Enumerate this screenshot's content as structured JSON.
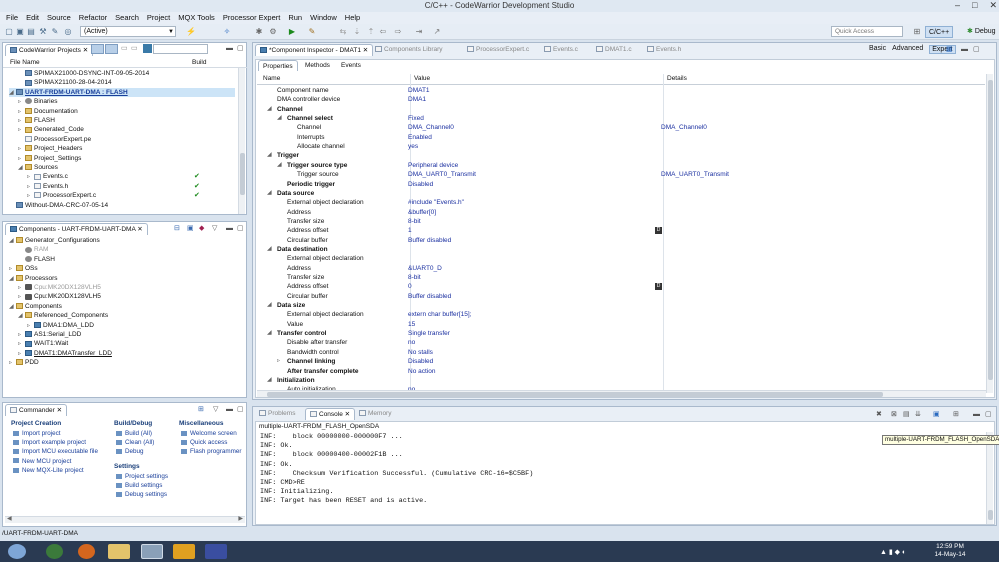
{
  "window": {
    "title": "C/C++ - CodeWarrior Development Studio"
  },
  "menu": [
    "File",
    "Edit",
    "Source",
    "Refactor",
    "Search",
    "Project",
    "MQX Tools",
    "Processor Expert",
    "Run",
    "Window",
    "Help"
  ],
  "toolbar": {
    "config_combo": "(Active)",
    "quick_access": "Quick Access"
  },
  "perspectives": {
    "cpp": "C/C++",
    "debug": "Debug"
  },
  "explorer": {
    "tab": "CodeWarrior Projects",
    "col_name": "File Name",
    "col_build": "Build",
    "items": [
      {
        "label": "SPIMAX21000-DSYNC-INT-09-05-2014",
        "kind": "proj",
        "depth": 1,
        "arrow": ""
      },
      {
        "label": "SPIMAX21100-28-04-2014",
        "kind": "proj",
        "depth": 1,
        "arrow": ""
      },
      {
        "label": "UART-FRDM-UART-DMA : FLASH",
        "kind": "proj",
        "depth": 0,
        "arrow": "◢",
        "selected": true
      },
      {
        "label": "Binaries",
        "kind": "gear",
        "depth": 1,
        "arrow": "▹"
      },
      {
        "label": "Documentation",
        "kind": "fold",
        "depth": 1,
        "arrow": "▹"
      },
      {
        "label": "FLASH",
        "kind": "fold",
        "depth": 1,
        "arrow": "▹"
      },
      {
        "label": "Generated_Code",
        "kind": "fold",
        "depth": 1,
        "arrow": "▹"
      },
      {
        "label": "ProcessorExpert.pe",
        "kind": "file",
        "depth": 1,
        "arrow": ""
      },
      {
        "label": "Project_Headers",
        "kind": "fold",
        "depth": 1,
        "arrow": "▹"
      },
      {
        "label": "Project_Settings",
        "kind": "fold",
        "depth": 1,
        "arrow": "▹"
      },
      {
        "label": "Sources",
        "kind": "fold",
        "depth": 1,
        "arrow": "◢"
      },
      {
        "label": "Events.c",
        "kind": "file",
        "depth": 2,
        "arrow": "▹",
        "check": "✔"
      },
      {
        "label": "Events.h",
        "kind": "file",
        "depth": 2,
        "arrow": "▹",
        "check": "✔"
      },
      {
        "label": "ProcessorExpert.c",
        "kind": "file",
        "depth": 2,
        "arrow": "▹",
        "check": "✔"
      },
      {
        "label": "Without-DMA-CRC-07-05-14",
        "kind": "proj",
        "depth": 0,
        "arrow": ""
      }
    ]
  },
  "components": {
    "tab": "Components - UART-FRDM-UART-DMA",
    "items": [
      {
        "label": "Generator_Configurations",
        "kind": "fold",
        "depth": 0,
        "arrow": "◢"
      },
      {
        "label": "RAM",
        "kind": "gear",
        "depth": 1,
        "arrow": "",
        "dim": true
      },
      {
        "label": "FLASH",
        "kind": "gear",
        "depth": 1,
        "arrow": ""
      },
      {
        "label": "OSs",
        "kind": "fold",
        "depth": 0,
        "arrow": "▹"
      },
      {
        "label": "Processors",
        "kind": "fold",
        "depth": 0,
        "arrow": "◢"
      },
      {
        "label": "Cpu:MK20DX128VLH5",
        "kind": "chip",
        "depth": 1,
        "arrow": "▹",
        "dim": true
      },
      {
        "label": "Cpu:MK20DX128VLH5",
        "kind": "chip",
        "depth": 1,
        "arrow": "▹"
      },
      {
        "label": "Components",
        "kind": "fold",
        "depth": 0,
        "arrow": "◢"
      },
      {
        "label": "Referenced_Components",
        "kind": "fold",
        "depth": 1,
        "arrow": "◢"
      },
      {
        "label": "DMA1:DMA_LDD",
        "kind": "comp",
        "depth": 2,
        "arrow": "▹"
      },
      {
        "label": "AS1:Serial_LDD",
        "kind": "comp",
        "depth": 1,
        "arrow": "▹"
      },
      {
        "label": "WAIT1:Wait",
        "kind": "comp",
        "depth": 1,
        "arrow": "▹"
      },
      {
        "label": "DMAT1:DMATransfer_LDD",
        "kind": "comp",
        "depth": 1,
        "arrow": "▹",
        "underline": true
      },
      {
        "label": "PDD",
        "kind": "fold",
        "depth": 0,
        "arrow": "▹"
      }
    ]
  },
  "inspector": {
    "tabs": [
      "*Component Inspector - DMAT1",
      "Components Library",
      "ProcessorExpert.c",
      "Events.c",
      "DMAT1.c",
      "Events.h"
    ],
    "modes": [
      "Basic",
      "Advanced",
      "Expert"
    ],
    "subtabs": [
      "Properties",
      "Methods",
      "Events"
    ],
    "cols": [
      "Name",
      "Value",
      "Details"
    ],
    "rows": [
      {
        "name": "Component name",
        "value": "DMAT1",
        "detail": "",
        "lvl": 0,
        "arrow": "",
        "bold": false
      },
      {
        "name": "DMA controller device",
        "value": "DMA1",
        "detail": "",
        "lvl": 0,
        "arrow": "",
        "bold": false
      },
      {
        "name": "Channel",
        "value": "",
        "detail": "",
        "lvl": 0,
        "arrow": "◢",
        "bold": true
      },
      {
        "name": "Channel select",
        "value": "Fixed",
        "detail": "",
        "lvl": 1,
        "arrow": "◢",
        "bold": true
      },
      {
        "name": "Channel",
        "value": "DMA_Channel0",
        "detail": "DMA_Channel0",
        "lvl": 2,
        "arrow": "",
        "bold": false
      },
      {
        "name": "Interrupts",
        "value": "Enabled",
        "detail": "",
        "lvl": 2,
        "arrow": "",
        "bold": false
      },
      {
        "name": "Allocate channel",
        "value": "yes",
        "detail": "",
        "lvl": 2,
        "arrow": "",
        "bold": false
      },
      {
        "name": "Trigger",
        "value": "",
        "detail": "",
        "lvl": 0,
        "arrow": "◢",
        "bold": true
      },
      {
        "name": "Trigger source type",
        "value": "Peripheral device",
        "detail": "",
        "lvl": 1,
        "arrow": "◢",
        "bold": true
      },
      {
        "name": "Trigger source",
        "value": "DMA_UART0_Transmit",
        "detail": "DMA_UART0_Transmit",
        "lvl": 2,
        "arrow": "",
        "bold": false
      },
      {
        "name": "Periodic trigger",
        "value": "Disabled",
        "detail": "",
        "lvl": 1,
        "arrow": "",
        "bold": true
      },
      {
        "name": "Data source",
        "value": "",
        "detail": "",
        "lvl": 0,
        "arrow": "◢",
        "bold": true
      },
      {
        "name": "External object declaration",
        "value": "#include \"Events.h\"",
        "detail": "",
        "lvl": 1,
        "arrow": "",
        "bold": false
      },
      {
        "name": "Address",
        "value": "&buffer[0]",
        "detail": "",
        "lvl": 1,
        "arrow": "",
        "bold": false
      },
      {
        "name": "Transfer size",
        "value": "8-bit",
        "detail": "",
        "lvl": 1,
        "arrow": "",
        "bold": false
      },
      {
        "name": "Address offset",
        "value": "1",
        "detail": "",
        "lvl": 1,
        "arrow": "",
        "bold": false,
        "dbtn": "D"
      },
      {
        "name": "Circular buffer",
        "value": "Buffer disabled",
        "detail": "",
        "lvl": 1,
        "arrow": "",
        "bold": false
      },
      {
        "name": "Data destination",
        "value": "",
        "detail": "",
        "lvl": 0,
        "arrow": "◢",
        "bold": true
      },
      {
        "name": "External object declaration",
        "value": "",
        "detail": "",
        "lvl": 1,
        "arrow": "",
        "bold": false
      },
      {
        "name": "Address",
        "value": "&UART0_D",
        "detail": "",
        "lvl": 1,
        "arrow": "",
        "bold": false
      },
      {
        "name": "Transfer size",
        "value": "8-bit",
        "detail": "",
        "lvl": 1,
        "arrow": "",
        "bold": false
      },
      {
        "name": "Address offset",
        "value": "0",
        "detail": "",
        "lvl": 1,
        "arrow": "",
        "bold": false,
        "dbtn": "D"
      },
      {
        "name": "Circular buffer",
        "value": "Buffer disabled",
        "detail": "",
        "lvl": 1,
        "arrow": "",
        "bold": false
      },
      {
        "name": "Data size",
        "value": "",
        "detail": "",
        "lvl": 0,
        "arrow": "◢",
        "bold": true
      },
      {
        "name": "External object declaration",
        "value": "extern char buffer[15];",
        "detail": "",
        "lvl": 1,
        "arrow": "",
        "bold": false
      },
      {
        "name": "Value",
        "value": "15",
        "detail": "",
        "lvl": 1,
        "arrow": "",
        "bold": false
      },
      {
        "name": "Transfer control",
        "value": "Single transfer",
        "detail": "",
        "lvl": 0,
        "arrow": "◢",
        "bold": true
      },
      {
        "name": "Disable after transfer",
        "value": "no",
        "detail": "",
        "lvl": 1,
        "arrow": "",
        "bold": false
      },
      {
        "name": "Bandwidth control",
        "value": "No stalls",
        "detail": "",
        "lvl": 1,
        "arrow": "",
        "bold": false
      },
      {
        "name": "Channel linking",
        "value": "Disabled",
        "detail": "",
        "lvl": 1,
        "arrow": "▹",
        "bold": true
      },
      {
        "name": "After transfer complete",
        "value": "No action",
        "detail": "",
        "lvl": 1,
        "arrow": "",
        "bold": true
      },
      {
        "name": "Initialization",
        "value": "",
        "detail": "",
        "lvl": 0,
        "arrow": "◢",
        "bold": true
      },
      {
        "name": "Auto initialization",
        "value": "no",
        "detail": "",
        "lvl": 1,
        "arrow": "",
        "bold": false
      }
    ]
  },
  "commander": {
    "tab": "Commander",
    "sections": [
      {
        "title": "Project Creation",
        "items": [
          "Import project",
          "Import example project",
          "Import MCU executable file",
          "New MCU project",
          "New MQX-Lite project"
        ]
      },
      {
        "title": "Build/Debug",
        "items": [
          "Build  (All)",
          "Clean  (All)",
          "Debug"
        ]
      },
      {
        "title": "Settings",
        "items": [
          "Project settings",
          "Build settings",
          "Debug settings"
        ]
      },
      {
        "title": "Miscellaneous",
        "items": [
          "Welcome screen",
          "Quick access",
          "Flash programmer"
        ]
      }
    ]
  },
  "console": {
    "tabs": [
      "Problems",
      "Console",
      "Memory"
    ],
    "header": "multiple-UART-FRDM_FLASH_OpenSDA",
    "tooltip": "multiple-UART-FRDM_FLASH_OpenSDA",
    "lines": [
      "INF:    block 00000000-000000F7 ...",
      "INF: Ok.",
      "INF:    block 00000400-00002F1B ...",
      "INF: Ok.",
      "INF:    Checksum Verification Successful. (Cumulative CRC-16=$C5BF)",
      "INF: CMD>RE",
      "INF: Initializing.",
      "INF: Target has been RESET and is active."
    ]
  },
  "status": {
    "text": "/UART-FRDM-UART-DMA"
  },
  "taskbar": {
    "time": "12:59 PM",
    "date": "14-May-14"
  }
}
